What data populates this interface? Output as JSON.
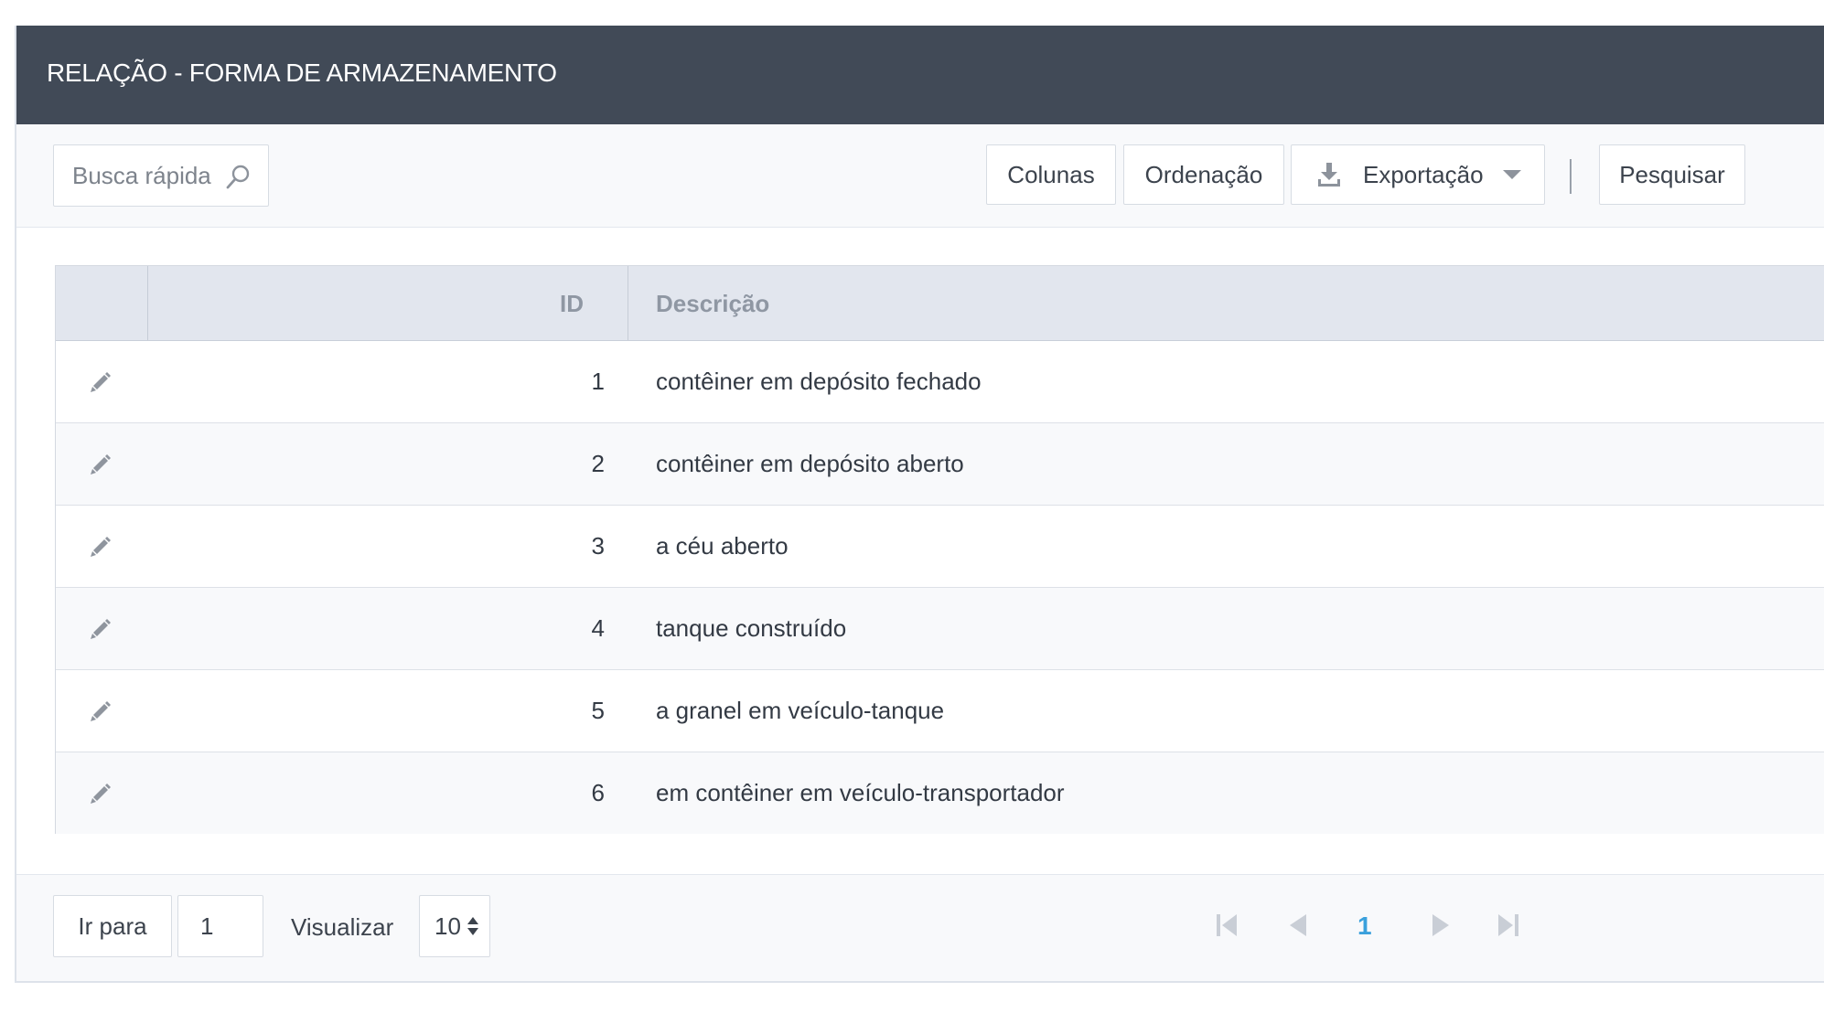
{
  "header": {
    "title": "RELAÇÃO - FORMA DE ARMAZENAMENTO"
  },
  "toolbar": {
    "search_placeholder": "Busca rápida",
    "columns_label": "Colunas",
    "sort_label": "Ordenação",
    "export_label": "Exportação",
    "search_button_label": "Pesquisar"
  },
  "table": {
    "columns": [
      "",
      "ID",
      "Descrição"
    ],
    "rows": [
      {
        "id": "1",
        "descricao": "contêiner em depósito fechado"
      },
      {
        "id": "2",
        "descricao": "contêiner em depósito aberto"
      },
      {
        "id": "3",
        "descricao": "a céu aberto"
      },
      {
        "id": "4",
        "descricao": "tanque construído"
      },
      {
        "id": "5",
        "descricao": "a granel em veículo-tanque"
      },
      {
        "id": "6",
        "descricao": "em contêiner em veículo-transportador"
      }
    ]
  },
  "footer": {
    "goto_label": "Ir para",
    "goto_value": "1",
    "view_label": "Visualizar",
    "page_size": "10",
    "current_page": "1"
  },
  "colors": {
    "header_bg": "#414a57",
    "table_header_bg": "#e2e6ee",
    "accent": "#3aa0dc"
  }
}
